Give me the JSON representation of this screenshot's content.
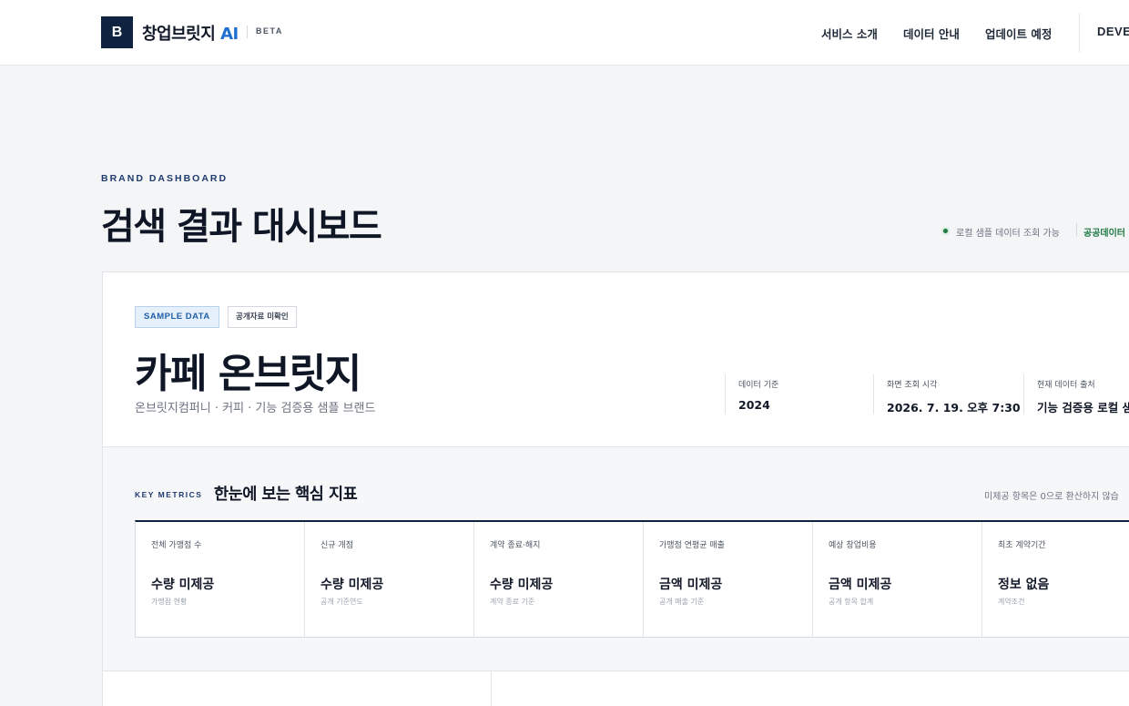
{
  "header": {
    "logo_letter": "B",
    "brand_name": "창업브릿지",
    "brand_ai": "AI",
    "beta": "BETA",
    "nav": [
      "서비스 소개",
      "데이터 안내",
      "업데이트 예정"
    ],
    "nav_dev": "DEVE"
  },
  "page": {
    "eyebrow": "BRAND DASHBOARD",
    "title": "검색 결과 대시보드",
    "status_text": "로컬 샘플 데이터 조회 가능",
    "status_source": "공공데이터"
  },
  "brand_card": {
    "chip_sample": "SAMPLE DATA",
    "chip_public": "공개자료 미확인",
    "name": "카페 온브릿지",
    "subtitle": "온브릿지컴퍼니 · 커피 · 기능 검증용 샘플 브랜드",
    "meta": [
      {
        "label": "데이터 기준",
        "value": "2024"
      },
      {
        "label": "화면 조회 시각",
        "value": "2026. 7. 19. 오후 7:30"
      },
      {
        "label": "현재 데이터 출처",
        "value": "기능 검증용 로컬 샘플"
      }
    ]
  },
  "key_metrics": {
    "eyebrow": "KEY METRICS",
    "title": "한눈에 보는 핵심 지표",
    "note": "미제공 항목은 0으로 환산하지 않습",
    "items": [
      {
        "label": "전체 가맹점 수",
        "value": "수량 미제공",
        "sub": "가맹점 현황"
      },
      {
        "label": "신규 개점",
        "value": "수량 미제공",
        "sub": "공개 기준연도"
      },
      {
        "label": "계약 종료·해지",
        "value": "수량 미제공",
        "sub": "계약 종료 기준"
      },
      {
        "label": "가맹점 연평균 매출",
        "value": "금액 미제공",
        "sub": "공개 매출 기준"
      },
      {
        "label": "예상 창업비용",
        "value": "금액 미제공",
        "sub": "공개 항목 합계"
      },
      {
        "label": "최초 계약기간",
        "value": "정보 없음",
        "sub": "계약조건"
      }
    ]
  },
  "colors": {
    "navy": "#0f2240",
    "accent_blue": "#1f6fd1",
    "status_green": "#1f7a44",
    "page_bg": "#f4f5f7"
  }
}
